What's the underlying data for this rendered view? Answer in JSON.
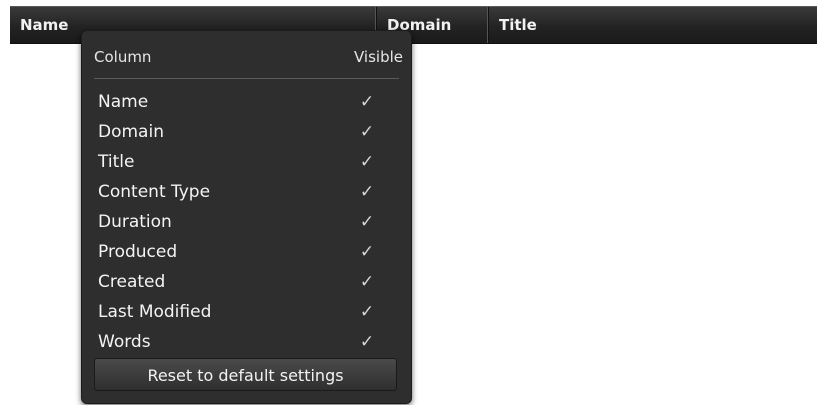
{
  "table_header": {
    "columns": [
      {
        "label": "Name"
      },
      {
        "label": "Domain"
      },
      {
        "label": "Title"
      }
    ]
  },
  "column_popup": {
    "header_column": "Column",
    "header_visible": "Visible",
    "rows": [
      {
        "label": "Name",
        "visible": true,
        "check": "✓"
      },
      {
        "label": "Domain",
        "visible": true,
        "check": "✓"
      },
      {
        "label": "Title",
        "visible": true,
        "check": "✓"
      },
      {
        "label": "Content Type",
        "visible": true,
        "check": "✓"
      },
      {
        "label": "Duration",
        "visible": true,
        "check": "✓"
      },
      {
        "label": "Produced",
        "visible": true,
        "check": "✓"
      },
      {
        "label": "Created",
        "visible": true,
        "check": "✓"
      },
      {
        "label": "Last Modified",
        "visible": true,
        "check": "✓"
      },
      {
        "label": "Words",
        "visible": true,
        "check": "✓"
      }
    ],
    "reset_label": "Reset to default settings"
  },
  "colors": {
    "header_bg": "#232323",
    "popup_bg": "#2e2e2e",
    "text": "#f4f4f4"
  }
}
